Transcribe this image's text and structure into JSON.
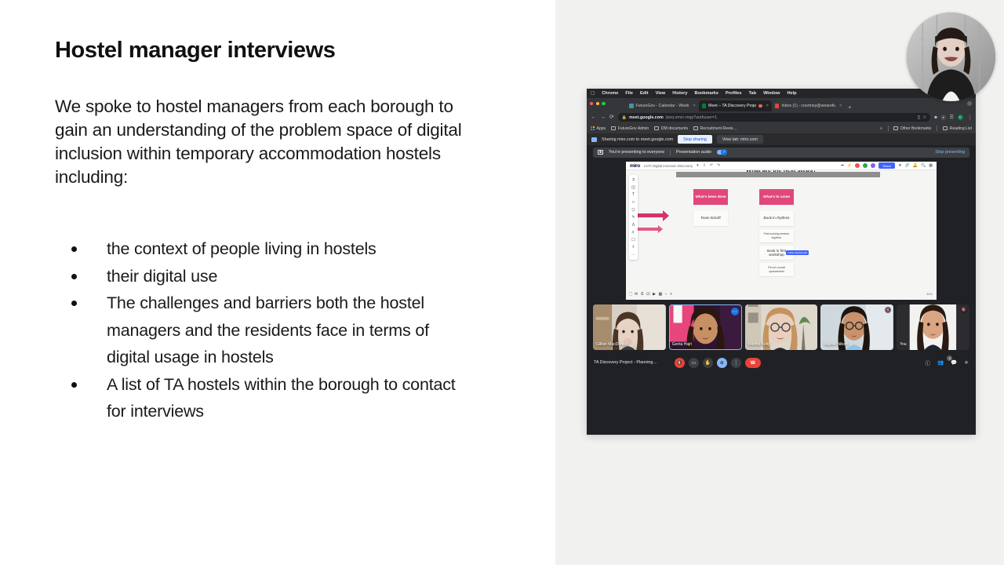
{
  "slide": {
    "title": "Hostel manager interviews",
    "intro": "We spoke to hostel managers from each borough to gain an understanding of the problem space of digital inclusion within temporary accommodation hostels including:",
    "bullets": [
      "the context of people living in hostels",
      "their digital use",
      "The challenges and barriers both the hostel managers and the residents face in terms of digital usage in hostels",
      "A list of TA hostels within the borough to contact for interviews"
    ]
  },
  "screenshot": {
    "macbar": {
      "apple": "",
      "items": [
        "Chrome",
        "File",
        "Edit",
        "View",
        "History",
        "Bookmarks",
        "Profiles",
        "Tab",
        "Window",
        "Help"
      ]
    },
    "tabs": [
      {
        "label": "FutureGov - Calendar - Week",
        "active": false
      },
      {
        "label": "Meet – TA Discovery Proje",
        "active": true
      },
      {
        "label": "Inbox (1) - courtney@wearefu",
        "active": false
      }
    ],
    "new_tab_label": "+",
    "omnibox": {
      "domain": "meet.google.com",
      "path": "/peq-smrc-mqp?authuser=1",
      "profile_initial": "C"
    },
    "bookmarks": {
      "left": [
        "Apps",
        "FutureGov Admin",
        "DM documents",
        "Recruitment Revie…"
      ],
      "overflow": "»",
      "right": [
        "Other Bookmarks",
        "Reading List"
      ]
    },
    "share_bar": {
      "text": "Sharing miro.com to meet.google.com",
      "stop_button": "Stop sharing",
      "view_tab_button": "View tab: miro.com"
    },
    "presenting_bar": {
      "status": "You're presenting to everyone",
      "audio_label": "Presentation audio",
      "stop_label": "Stop presenting"
    },
    "miro": {
      "logo": "miro",
      "board_title": "LOTI Digital Inclusion Discovery",
      "share_button": "Share",
      "canvas_heading": "What are the next steps?",
      "zoom_label": "34%",
      "cursor_tag": "Gillian MacDonald",
      "columns": [
        {
          "header": "What's been done",
          "notes": [
            "Team kickoff"
          ]
        },
        {
          "header": "What's to come",
          "notes": [
            "Book in rhythms",
            "First working session together",
            "Book in first workshop",
            "Fill out council spreadsheet"
          ]
        }
      ]
    },
    "participants": [
      {
        "name": "Gillian MacDonald",
        "speaking": false,
        "muted": false
      },
      {
        "name": "Genta Hajri",
        "speaking": true,
        "muted": false
      },
      {
        "name": "Rachel Kelly",
        "speaking": false,
        "muted": false
      },
      {
        "name": "Sophie Nilson",
        "speaking": false,
        "muted": true
      },
      {
        "name": "You",
        "speaking": false,
        "muted": true
      }
    ],
    "controls": {
      "meeting_name": "TA Discovery Project - Planning…",
      "participant_count": "6",
      "mic_state": "muted",
      "present_state": "active"
    }
  },
  "colors": {
    "panel_bg": "#f1f1f0",
    "chrome_dark": "#35363a",
    "meet_dark": "#202124",
    "accent_blue": "#8ab4f8",
    "miro_pink": "#e0487b",
    "arrow_pink": "#d6336c",
    "red": "#ea4335"
  }
}
